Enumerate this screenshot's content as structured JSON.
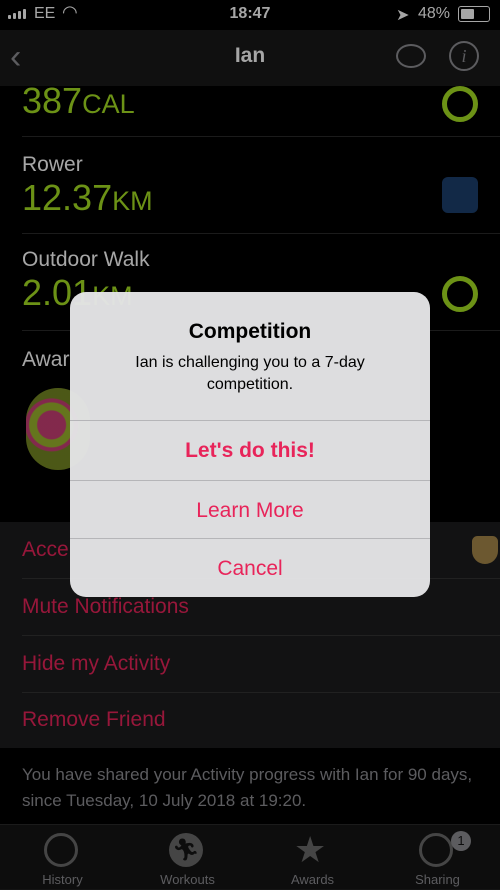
{
  "status_bar": {
    "carrier": "EE",
    "time": "18:47",
    "battery": "48%"
  },
  "nav": {
    "title": "Ian"
  },
  "metrics": [
    {
      "value": "387",
      "unit": "CAL"
    },
    {
      "name": "Rower",
      "value": "12.37",
      "unit": "KM"
    },
    {
      "name": "Outdoor Walk",
      "value": "2.01",
      "unit": "KM"
    }
  ],
  "awards": {
    "label": "Awar"
  },
  "actions": {
    "accept": "Acce",
    "mute": "Mute Notifications",
    "hide": "Hide my Activity",
    "remove": "Remove Friend"
  },
  "footnote": "You have shared your Activity progress with Ian for 90 days, since Tuesday, 10 July 2018 at 19:20.",
  "tabs": [
    {
      "label": "History"
    },
    {
      "label": "Workouts"
    },
    {
      "label": "Awards"
    },
    {
      "label": "Sharing",
      "badge": "1"
    }
  ],
  "alert": {
    "title": "Competition",
    "message": "Ian is challenging you to a 7-day competition.",
    "buttons": {
      "primary": "Let's do this!",
      "learn_more": "Learn More",
      "cancel": "Cancel"
    }
  },
  "colors": {
    "accent": "#e8245a",
    "metric_green": "#a6e022",
    "background": "#000000"
  }
}
